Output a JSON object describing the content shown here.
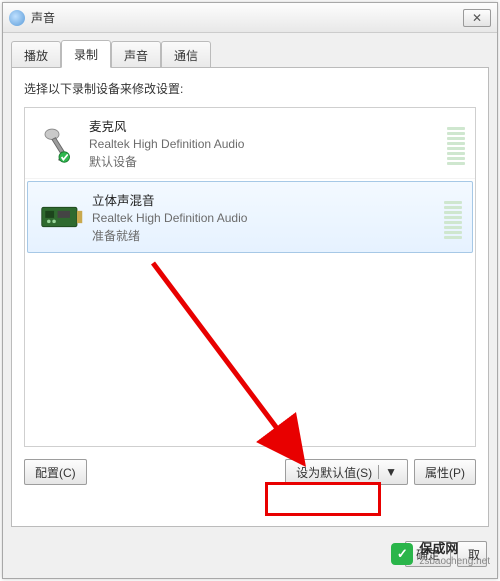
{
  "window": {
    "title": "声音",
    "close_glyph": "✕"
  },
  "tabs": {
    "playback": "播放",
    "recording": "录制",
    "sounds": "声音",
    "communications": "通信"
  },
  "panel": {
    "instruction": "选择以下录制设备来修改设置:"
  },
  "devices": [
    {
      "name": "麦克风",
      "description": "Realtek High Definition Audio",
      "status": "默认设备",
      "icon": "microphone",
      "selected": false,
      "default": true
    },
    {
      "name": "立体声混音",
      "description": "Realtek High Definition Audio",
      "status": "准备就绪",
      "icon": "sound-card",
      "selected": true,
      "default": false
    }
  ],
  "buttons": {
    "configure": "配置(C)",
    "set_default": "设为默认值(S)",
    "properties": "属性(P)",
    "ok": "确定",
    "cancel": "取",
    "caret": "▼"
  },
  "watermark": {
    "brand": "保成网",
    "url": "zsbaocheng.net",
    "badge": "✓"
  },
  "colors": {
    "highlight": "#e80000",
    "accent": "#2ab54a"
  }
}
